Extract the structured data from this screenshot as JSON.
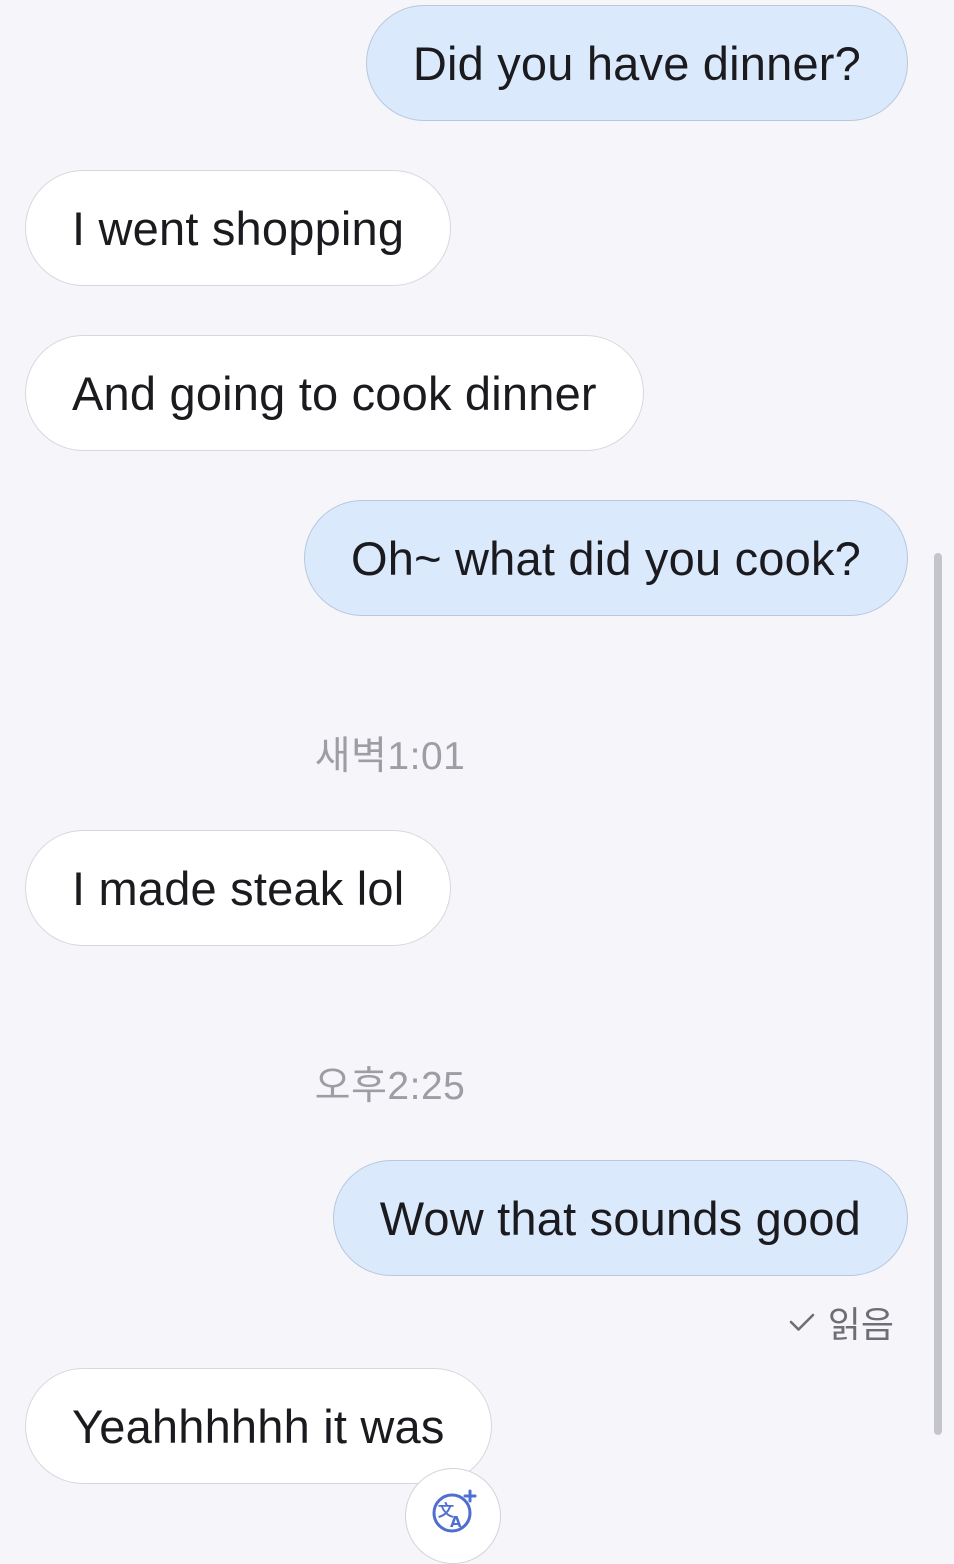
{
  "messages": [
    {
      "direction": "sent",
      "text": "Did you have dinner?"
    },
    {
      "direction": "received",
      "text": "I went shopping"
    },
    {
      "direction": "received",
      "text": "And going to cook dinner"
    },
    {
      "direction": "sent",
      "text": "Oh~ what did you cook?"
    },
    {
      "direction": "received",
      "text": "I made steak lol"
    },
    {
      "direction": "sent",
      "text": "Wow that sounds good"
    },
    {
      "direction": "received",
      "text": "Yeahhhhhh it was"
    }
  ],
  "timestamps": [
    "새벽1:01",
    "오후2:25"
  ],
  "read_receipt": {
    "label": "읽음",
    "icon": "checkmark-icon"
  },
  "translate_button": {
    "icon": "translate-icon"
  },
  "colors": {
    "sent_bubble": "#dae9fb",
    "received_bubble": "#ffffff",
    "background": "#f6f6fa",
    "accent": "#4f6fd0"
  }
}
